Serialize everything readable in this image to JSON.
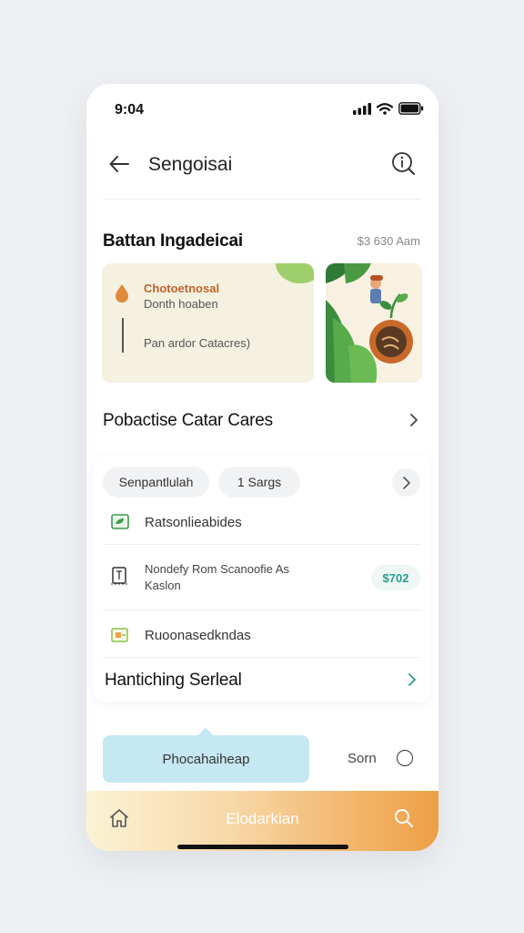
{
  "status_bar": {
    "time": "9:04",
    "icons": [
      "signal-icon",
      "wifi-icon",
      "battery-icon"
    ]
  },
  "header": {
    "title": "Sengoisai",
    "back_icon": "arrow-left-icon",
    "info_icon": "info-search-icon"
  },
  "section": {
    "title": "Battan Ingadeicai",
    "meta": "$3 630 Aam"
  },
  "card": {
    "title": "Chotoetnosal",
    "subtitle": "Donth hoaben",
    "footer": "Pan ardor Catacres)"
  },
  "row_head": {
    "title": "Pobactise Catar Cares"
  },
  "filters": {
    "chip1": "Senpantlulah",
    "chip2": "1 Sargs"
  },
  "list": [
    {
      "text": "Ratsonlieabides",
      "icon": "leaf-card-icon"
    },
    {
      "text_line1": "Nondefy Rom Scanoofie As",
      "text_line2": "Kaslon",
      "price": "$702",
      "icon": "document-icon"
    },
    {
      "text": "Ruoonasedkndas",
      "icon": "folder-icon"
    }
  ],
  "panel_footer": {
    "title": "Hantiching Serleal"
  },
  "actions": {
    "primary": "Phocahaiheap",
    "secondary": "Sorn"
  },
  "tabbar": {
    "label": "Elodarkian",
    "home_icon": "home-icon",
    "search_icon": "search-icon"
  },
  "colors": {
    "accent_orange": "#ee9f43",
    "card_bg": "#f5f1e1",
    "button_bg": "#c5e8f3",
    "price_teal": "#2a9d8f",
    "card_title": "#c0632a"
  }
}
